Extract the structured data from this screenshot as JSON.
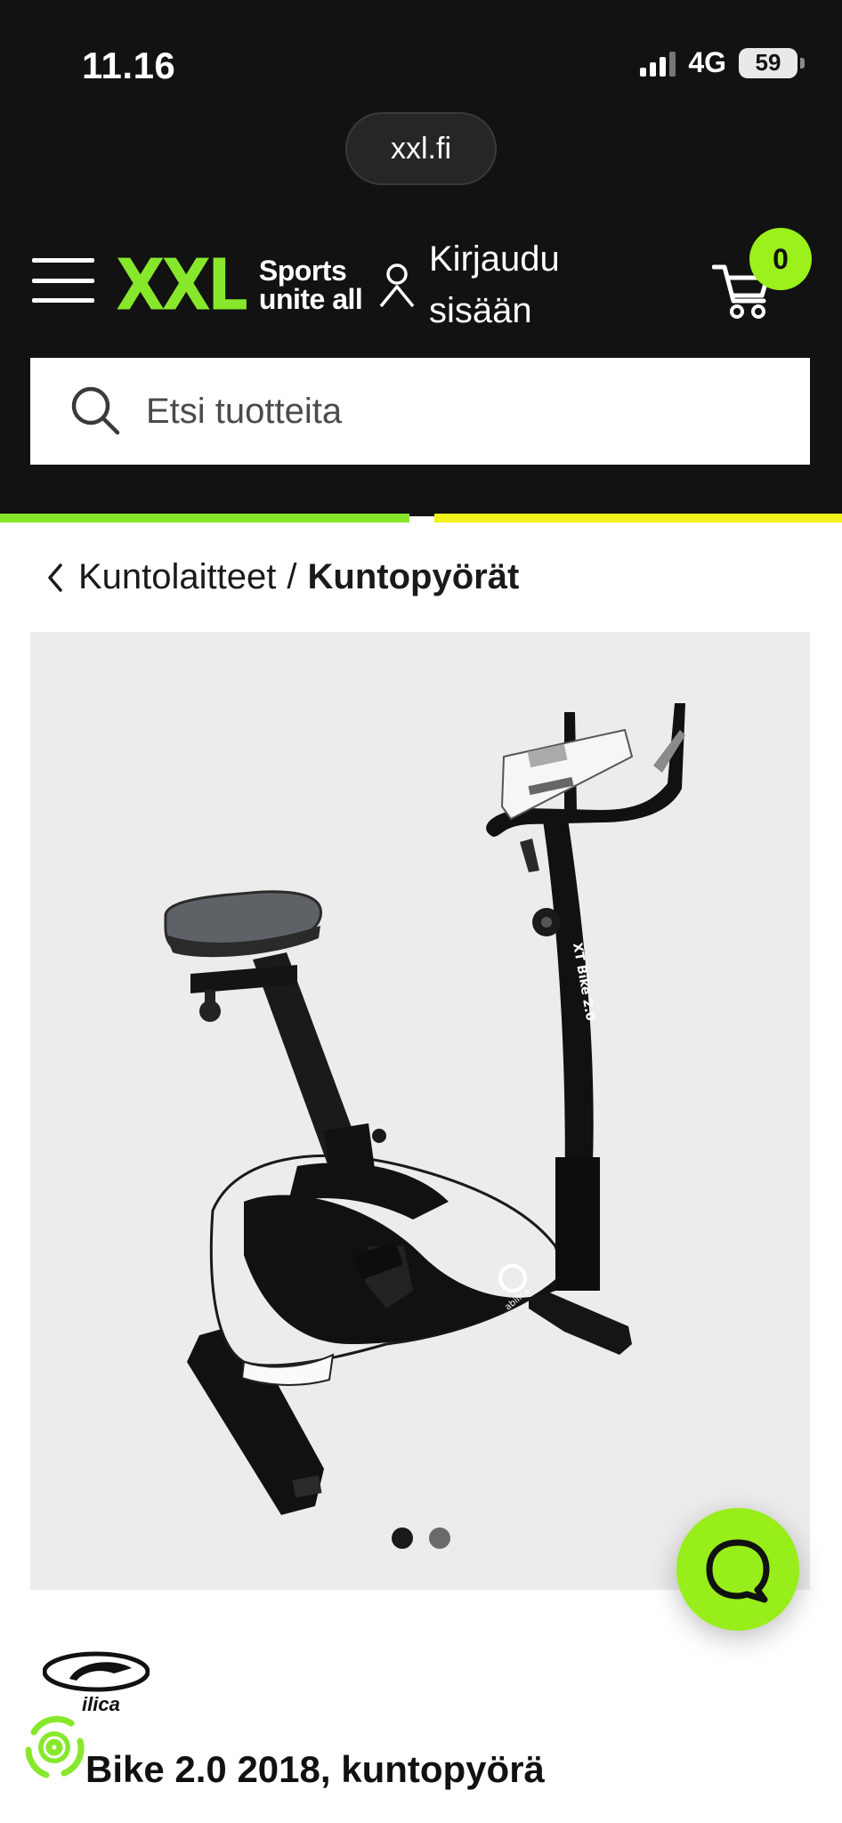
{
  "status_bar": {
    "time": "11.16",
    "network": "4G",
    "battery": "59"
  },
  "browser": {
    "url": "xxl.fi"
  },
  "header": {
    "logo_text": "XXL",
    "tagline_line1": "Sports",
    "tagline_line2": "unite all",
    "login_line1": "Kirjaudu",
    "login_line2": "sisään",
    "cart_count": "0"
  },
  "search": {
    "placeholder": "Etsi tuotteita"
  },
  "breadcrumb": {
    "parent": "Kuntolaitteet",
    "separator": "/",
    "current": "Kuntopyörät"
  },
  "product": {
    "image_alt": "XT Bike 2.0 kuntopyörä",
    "frame_text": "XT Bike 2.0",
    "brand_logo_text": "abilica",
    "brand_visible_text": "ilica",
    "title": "Bike 2.0 2018, kuntopyörä"
  },
  "gallery": {
    "count": 2,
    "active_index": 0
  },
  "colors": {
    "accent_green": "#87e82b",
    "chat_green": "#98ee1a",
    "accent_yellow": "#f2f21b",
    "header_bg": "#121212"
  },
  "icons": [
    "menu-icon",
    "user-icon",
    "cart-icon",
    "search-icon",
    "chevron-left-icon",
    "chat-icon",
    "recycle-bike-icon"
  ]
}
